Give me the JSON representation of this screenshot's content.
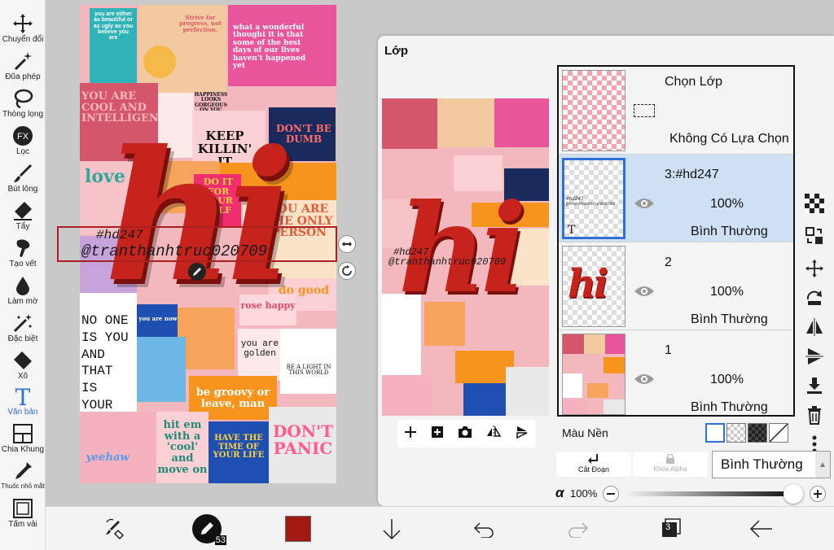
{
  "toolbar": {
    "tools": [
      {
        "label": "Chuyển đổi",
        "icon": "move-icon"
      },
      {
        "label": "Đũa phép",
        "icon": "magic-wand-icon"
      },
      {
        "label": "Thòng lọng",
        "icon": "lasso-icon"
      },
      {
        "label": "Lọc",
        "icon": "fx-icon"
      },
      {
        "label": "Bút lông",
        "icon": "brush-icon"
      },
      {
        "label": "Tẩy",
        "icon": "eraser-icon"
      },
      {
        "label": "Tạo vết",
        "icon": "smudge-icon"
      },
      {
        "label": "Làm mờ",
        "icon": "blur-icon"
      },
      {
        "label": "Đặc biệt",
        "icon": "special-brush-icon"
      },
      {
        "label": "Xô",
        "icon": "bucket-icon"
      },
      {
        "label": "Văn bản",
        "icon": "text-icon",
        "active": true
      },
      {
        "label": "Chia Khung",
        "icon": "frame-divider-icon"
      },
      {
        "label": "Thuốc nhỏ mắt",
        "icon": "eyedropper-icon"
      },
      {
        "label": "Tấm vải",
        "icon": "canvas-icon"
      }
    ]
  },
  "canvas": {
    "stamp_line1": "#hd247",
    "stamp_line2": "@tranthanhtruc020709",
    "art_text": "hi",
    "tiles": {
      "strive": "Strive for progress, not perfection.",
      "wonderful": "what a wonderful thought it is that some of the best days of our lives haven't happened yet",
      "either": "you are either as beautiful or as ugly as you believe you are",
      "keep": "KEEP KILLIN' IT",
      "dont_be_dumb": "DON'T BE DUMB",
      "happiness": "HAPPINESS LOOKS GORGEOUS ON YOU",
      "cool": "YOU ARE COOL AND INTELLIGENT",
      "love": "love",
      "do_it": "DO IT FOR YOUR SELF",
      "you_are_only": "YOU ARE THE ONLY PERSON",
      "good": "good",
      "do_good": "do good",
      "no_one": "NO ONE IS YOU AND THAT IS YOUR POWER.",
      "golden": "you are golden",
      "light": "BE A LIGHT IN THIS WORLD",
      "groovy": "be groovy or leave, man",
      "hit": "hit em with a 'cool' and move on",
      "time": "HAVE THE TIME OF YOUR LIFE",
      "panic": "DON'T PANIC",
      "yeehaw": "yeehaw",
      "rose": "rose happy",
      "now": "you are now"
    }
  },
  "panel": {
    "title": "Lớp",
    "selection_layer": {
      "name": "Chọn Lớp",
      "status": "Không Có Lựa Chọn"
    },
    "layers": [
      {
        "name": "3:#hd247",
        "opacity": "100%",
        "mode": "Bình Thường",
        "active": true
      },
      {
        "name": "2",
        "opacity": "100%",
        "mode": "Bình Thường",
        "active": false
      },
      {
        "name": "1",
        "opacity": "100%",
        "mode": "Bình Thường",
        "active": false
      }
    ],
    "background_label": "Màu Nền",
    "clipping_label": "Cắt Đoạn",
    "alpha_lock_label": "Khóa Alpha",
    "blend_mode": "Bình Thường",
    "alpha_symbol": "α",
    "alpha_value": "100%",
    "alpha_level": 1.0
  },
  "bottombar": {
    "brush_size": "53",
    "layer_count": "3",
    "color": "#a31a14"
  },
  "colors": {
    "accent": "#2f6fd6",
    "text_red": "#c6231c",
    "active_layer": "#cfdff4"
  }
}
